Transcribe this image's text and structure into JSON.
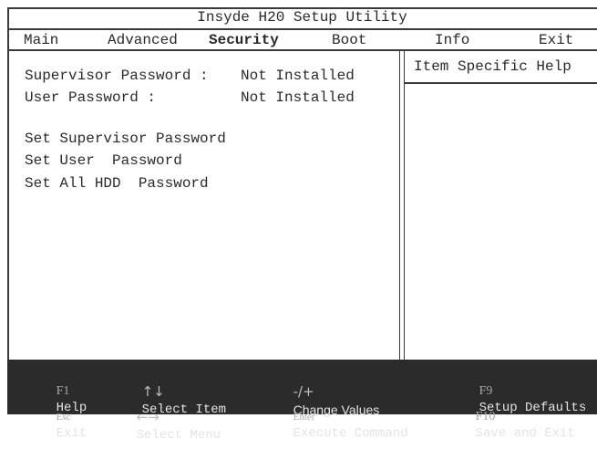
{
  "window": {
    "title": "Insyde H20 Setup Utility"
  },
  "menu": {
    "items": [
      {
        "label": "Main",
        "active": false
      },
      {
        "label": "Advanced",
        "active": false
      },
      {
        "label": "Security",
        "active": true
      },
      {
        "label": "Boot",
        "active": false
      },
      {
        "label": "Info",
        "active": false
      },
      {
        "label": "Exit",
        "active": false
      }
    ]
  },
  "main": {
    "status": [
      {
        "label": "Supervisor Password :",
        "value": "Not Installed"
      },
      {
        "label": "User Password :",
        "value": "Not Installed"
      }
    ],
    "actions": [
      {
        "label": "Set Supervisor Password"
      },
      {
        "label": "Set User  Password"
      },
      {
        "label": "Set All HDD  Password"
      }
    ]
  },
  "help_panel": {
    "title": "Item Specific Help"
  },
  "footer": {
    "row1": [
      {
        "key": "F1",
        "key_icon": "f1-key",
        "label": "Help"
      },
      {
        "key": "↑↓",
        "key_icon": "up-down-arrows-icon",
        "label": "Select Item"
      },
      {
        "key": "-/+",
        "key_icon": "minus-plus-icon",
        "label": "Change Values"
      },
      {
        "key": "F9",
        "key_icon": "f9-key",
        "label": "Setup Defaults"
      }
    ],
    "row2": [
      {
        "key": "Esc",
        "key_icon": "esc-key",
        "label": "Exit"
      },
      {
        "key": "←→",
        "key_icon": "left-right-arrows-icon",
        "label": "Select Menu"
      },
      {
        "key": "Enter",
        "key_icon": "enter-key",
        "label": "Execute Command"
      },
      {
        "key": "F10",
        "key_icon": "f10-key",
        "label": "Save and Exit"
      }
    ]
  }
}
